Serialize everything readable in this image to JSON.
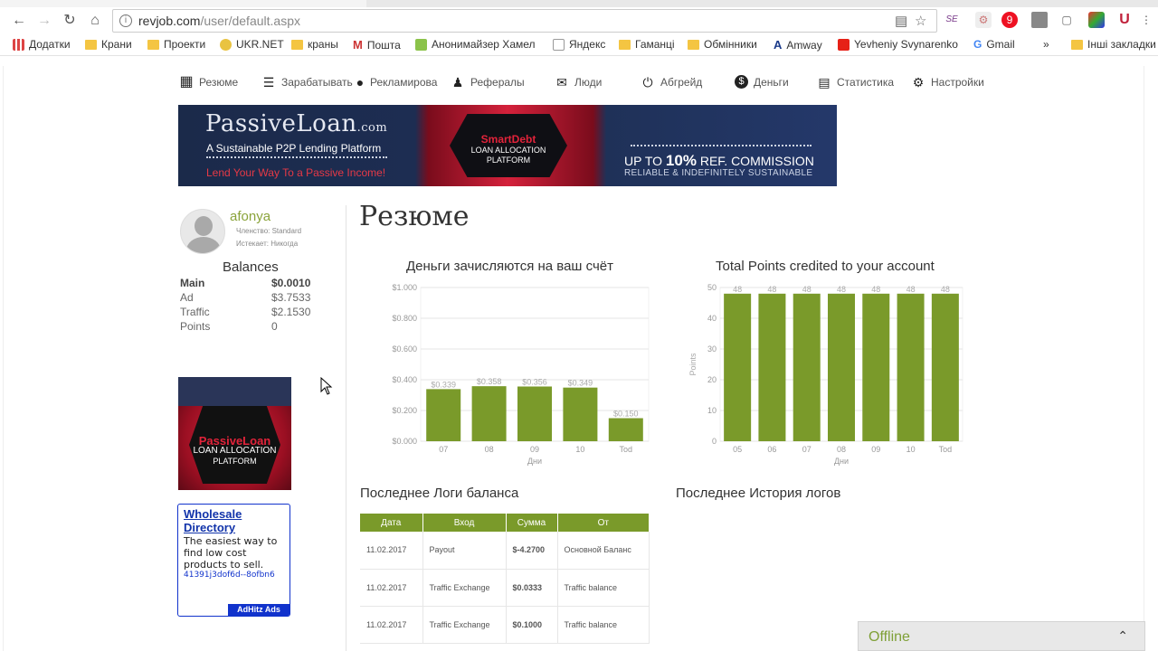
{
  "browser": {
    "url_domain": "revjob.com",
    "url_path": "/user/default.aspx",
    "bookmarks": [
      "Додатки",
      "Крани",
      "Проекти",
      "UKR.NET",
      "краны",
      "Пошта",
      "Анонимайзер Хамел",
      "Яндекс",
      "Гаманці",
      "Обмінники",
      "Amway",
      "Yevheniy Svynarenko",
      "Gmail",
      "»",
      "Інші закладки"
    ]
  },
  "nav": {
    "items": [
      {
        "label": "Резюме",
        "icon": "grid-icon"
      },
      {
        "label": "Зарабатывать",
        "icon": "list-icon"
      },
      {
        "label": "Рекламирова",
        "icon": "microphone-icon"
      },
      {
        "label": "Рефералы",
        "icon": "users-icon"
      },
      {
        "label": "Люди",
        "icon": "envelope-icon"
      },
      {
        "label": "Абгрейд",
        "icon": "power-icon"
      },
      {
        "label": "Деньги",
        "icon": "dollar-icon"
      },
      {
        "label": "Статистика",
        "icon": "bar-chart-icon"
      },
      {
        "label": "Настройки",
        "icon": "gear-icon"
      }
    ]
  },
  "banner": {
    "logo_main": "PassiveLoan",
    "logo_tld": ".com",
    "subtitle": "A Sustainable P2P Lending Platform",
    "tagline": "Lend Your Way To a Passive Income!",
    "center_brand": "SmartDebt",
    "center_line1": "LOAN ALLOCATION",
    "center_line2": "PLATFORM",
    "ref_prefix": "UP TO",
    "ref_pct": "10%",
    "ref_suffix": "REF. COMMISSION",
    "ref_sub": "RELIABLE & INDEFINITELY SUSTAINABLE"
  },
  "profile": {
    "username": "afonya",
    "membership": "Членство: Standard",
    "expires": "Истекает: Никогда"
  },
  "balances": {
    "title": "Balances",
    "rows": [
      {
        "label": "Main",
        "value": "$0.0010"
      },
      {
        "label": "Ad",
        "value": "$3.7533"
      },
      {
        "label": "Traffic",
        "value": "$2.1530"
      },
      {
        "label": "Points",
        "value": "0"
      }
    ]
  },
  "side_ad": {
    "brand": "PassiveLoan",
    "line1": "LOAN ALLOCATION",
    "line2": "PLATFORM"
  },
  "text_ad": {
    "headline": "Wholesale Directory",
    "description": "The easiest way to find low cost products to sell.",
    "link": "41391j3dof6d--8ofbn6",
    "tag": "AdHitz Ads"
  },
  "main": {
    "title": "Резюме",
    "balance_log_title": "Последнее Логи баланса",
    "history_log_title": "Последнее История логов"
  },
  "chart_data": [
    {
      "type": "bar",
      "title": "Деньги зачисляются на ваш счёт",
      "xlabel": "Дни",
      "ylabel": "",
      "categories": [
        "07",
        "08",
        "09",
        "10",
        "Tod"
      ],
      "values": [
        0.339,
        0.358,
        0.356,
        0.349,
        0.15
      ],
      "value_labels": [
        "$0.339",
        "$0.358",
        "$0.356",
        "$0.349",
        "$0.150"
      ],
      "ylim": [
        0,
        1.0
      ],
      "yticks": [
        "$0.000",
        "$0.200",
        "$0.400",
        "$0.600",
        "$0.800",
        "$1.000"
      ],
      "grid": true,
      "color": "#7a9a2a"
    },
    {
      "type": "bar",
      "title": "Total Points credited to your account",
      "xlabel": "Дни",
      "ylabel": "Points",
      "categories": [
        "05",
        "06",
        "07",
        "08",
        "09",
        "10",
        "Tod"
      ],
      "values": [
        48,
        48,
        48,
        48,
        48,
        48,
        48
      ],
      "value_labels": [
        "48",
        "48",
        "48",
        "48",
        "48",
        "48",
        "48"
      ],
      "ylim": [
        0,
        50
      ],
      "yticks": [
        "0",
        "10",
        "20",
        "30",
        "40",
        "50"
      ],
      "grid": true,
      "color": "#7a9a2a"
    }
  ],
  "log_table": {
    "headers": [
      "Дата",
      "Вход",
      "Сумма",
      "От"
    ],
    "rows": [
      {
        "date": "11.02.2017",
        "type": "Payout",
        "amount": "$-4.2700",
        "from": "Основной Баланс",
        "kind": "neg"
      },
      {
        "date": "11.02.2017",
        "type": "Traffic Exchange",
        "amount": "$0.0333",
        "from": "Traffic balance",
        "kind": "pos"
      },
      {
        "date": "11.02.2017",
        "type": "Traffic Exchange",
        "amount": "$0.1000",
        "from": "Traffic balance",
        "kind": "pos"
      }
    ]
  },
  "chat": {
    "status": "Offline"
  },
  "colors": {
    "accent_green": "#7a9a2a",
    "username_green": "#8aa33a",
    "negative_red": "#b0283a"
  }
}
